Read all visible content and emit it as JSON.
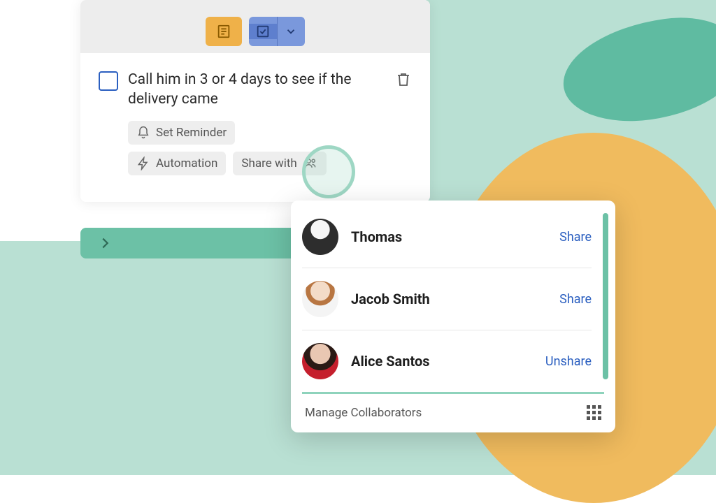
{
  "task": {
    "text": "Call him in 3 or 4 days to see if the delivery came",
    "checked": false
  },
  "chips": {
    "reminder": "Set Reminder",
    "automation": "Automation",
    "share_with": "Share with"
  },
  "share_popup": {
    "people": [
      {
        "name": "Thomas",
        "action": "Share"
      },
      {
        "name": "Jacob Smith",
        "action": "Share"
      },
      {
        "name": "Alice Santos",
        "action": "Unshare"
      }
    ],
    "footer": "Manage Collaborators"
  },
  "colors": {
    "teal": "#6cc1a6",
    "orange": "#f0bb5e",
    "blue": "#7a98dc",
    "link": "#2b5fc0"
  }
}
